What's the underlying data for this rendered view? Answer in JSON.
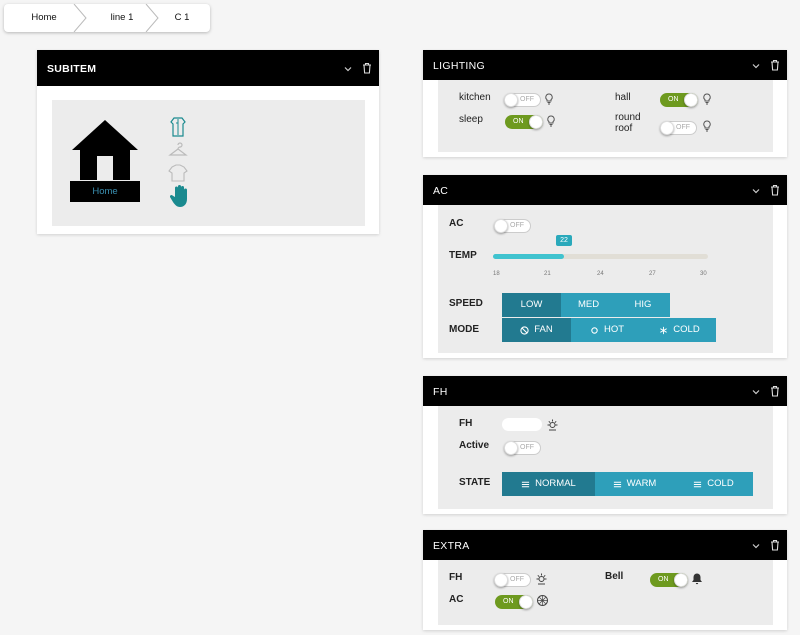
{
  "breadcrumb": [
    "Home",
    "line 1",
    "C 1"
  ],
  "subitem": {
    "title": "SUBITEM",
    "house_label": "Home"
  },
  "lighting": {
    "title": "LIGHTING",
    "items": [
      {
        "label": "kitchen",
        "state": "OFF"
      },
      {
        "label": "hall",
        "state": "ON"
      },
      {
        "label": "sleep",
        "state": "ON"
      },
      {
        "label": "round roof",
        "state": "OFF"
      }
    ]
  },
  "ac": {
    "title": "AC",
    "ac_label": "AC",
    "ac_state": "OFF",
    "temp_label": "TEMP",
    "temp_value": "22",
    "temp_fraction": 0.33,
    "ticks": [
      "18",
      "21",
      "24",
      "27",
      "30"
    ],
    "speed_label": "SPEED",
    "speed_options": [
      "LOW",
      "MED",
      "HIG"
    ],
    "speed_selected": "LOW",
    "mode_label": "MODE",
    "mode_options": [
      "FAN",
      "HOT",
      "COLD"
    ],
    "mode_selected": "FAN"
  },
  "fh": {
    "title": "FH",
    "fh_label": "FH",
    "active_label": "Active",
    "active_state": "OFF",
    "state_label": "STATE",
    "state_options": [
      "NORMAL",
      "WARM",
      "COLD"
    ],
    "state_selected": "NORMAL"
  },
  "extra": {
    "title": "EXTRA",
    "fh_label": "FH",
    "fh_state": "OFF",
    "ac_label": "AC",
    "ac_state": "ON",
    "bell_label": "Bell",
    "bell_state": "ON"
  },
  "colors": {
    "header": "#000000",
    "toggle_on": "#6e9a1f",
    "segment": "#2e9fba",
    "segment_selected": "#227a90",
    "slider_fill": "#40c3cf",
    "house_label": "#3a8fb0",
    "icon_teal": "#1a8a8f"
  }
}
